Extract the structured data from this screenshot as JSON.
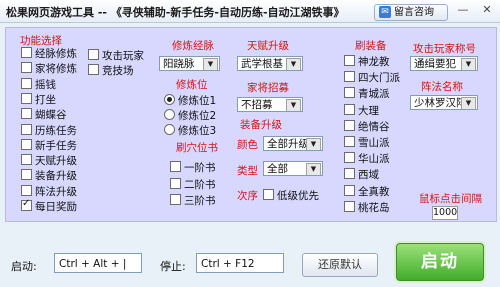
{
  "window": {
    "title": "松果网页游戏工具 --",
    "title_suffix": "《寻侠辅助-新手任务-自动历练-自动江湖铁事》",
    "help_button": "留言咨询",
    "minimize": "—",
    "close": "✕"
  },
  "functions": {
    "heading": "功能选择",
    "items": [
      {
        "label": "经脉修炼",
        "checked": false
      },
      {
        "label": "家将修炼",
        "checked": false
      },
      {
        "label": "摇钱",
        "checked": false
      },
      {
        "label": "打坐",
        "checked": false
      },
      {
        "label": "蝴蝶谷",
        "checked": false
      },
      {
        "label": "历练任务",
        "checked": false
      },
      {
        "label": "新手任务",
        "checked": false
      },
      {
        "label": "天赋升级",
        "checked": false
      },
      {
        "label": "装备升级",
        "checked": false
      },
      {
        "label": "阵法升级",
        "checked": false
      },
      {
        "label": "每日奖励",
        "checked": true
      }
    ],
    "extra": [
      {
        "label": "攻击玩家",
        "checked": false
      },
      {
        "label": "竞技场",
        "checked": false
      }
    ]
  },
  "meridian": {
    "heading": "修炼经脉",
    "value": "阳跷脉",
    "seat_heading": "修炼位",
    "seats": [
      {
        "label": "修炼位1",
        "checked": true
      },
      {
        "label": "修炼位2",
        "checked": false
      },
      {
        "label": "修炼位3",
        "checked": false
      }
    ]
  },
  "refresh_book": {
    "heading": "刷穴位书",
    "items": [
      {
        "label": "一阶书",
        "checked": false
      },
      {
        "label": "二阶书",
        "checked": false
      },
      {
        "label": "三阶书",
        "checked": false
      }
    ]
  },
  "talent": {
    "heading": "天赋升级",
    "value": "武学根基",
    "recruit_heading": "家将招募",
    "recruit_value": "不招募"
  },
  "equipment": {
    "heading": "装备升级",
    "color_label": "颜色",
    "color_value": "全部升级",
    "type_label": "类型",
    "type_value": "全部",
    "order_label": "次序",
    "order_option": "低级优先",
    "order_checked": false
  },
  "brush": {
    "heading": "刷装备",
    "items": [
      {
        "label": "神龙教",
        "checked": false
      },
      {
        "label": "四大门派",
        "checked": false
      },
      {
        "label": "青城派",
        "checked": false
      },
      {
        "label": "大理",
        "checked": false
      },
      {
        "label": "绝情谷",
        "checked": false
      },
      {
        "label": "雪山派",
        "checked": false
      },
      {
        "label": "华山派",
        "checked": false
      },
      {
        "label": "西域",
        "checked": false
      },
      {
        "label": "全真教",
        "checked": false
      },
      {
        "label": "桃花岛",
        "checked": false
      }
    ]
  },
  "attack": {
    "heading": "攻击玩家称号",
    "value": "通缉要犯",
    "formation_heading": "阵法名称",
    "formation_value": "少林罗汉阵"
  },
  "click_interval": {
    "heading": "鼠标点击间隔",
    "value": "1000"
  },
  "bottom": {
    "start_label": "启动:",
    "start_hotkey": "Ctrl + Alt + |",
    "stop_label": "停止:",
    "stop_hotkey": "Ctrl + F12",
    "restore_button": "还原默认",
    "start_button": "启动"
  }
}
